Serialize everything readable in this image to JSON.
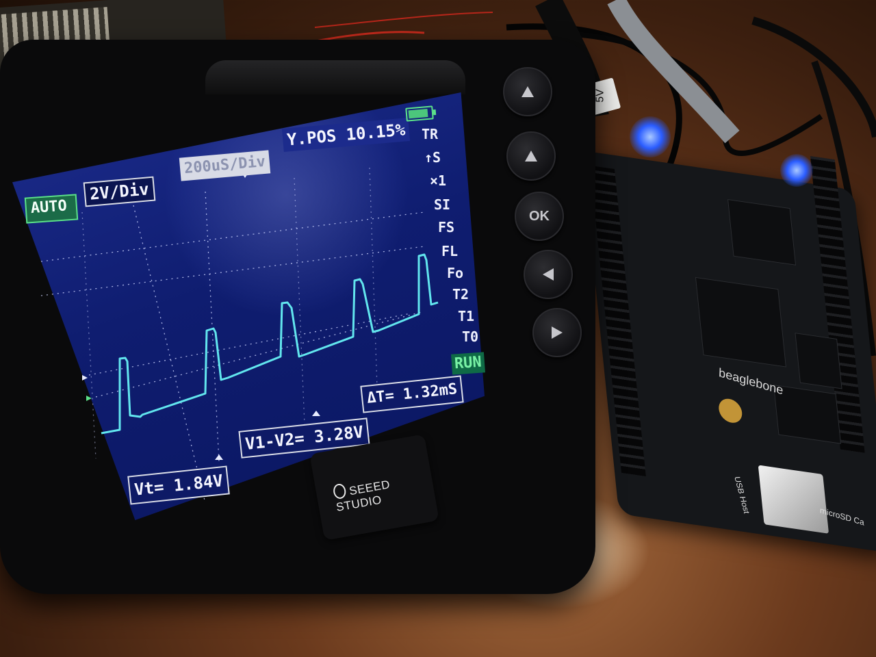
{
  "scope": {
    "brand": "SEEED STUDIO",
    "mode": "AUTO",
    "volts_per_div": "2V/Div",
    "time_per_div": "200uS/Div",
    "ypos": "Y.POS 10.15%",
    "side_menu": [
      "TR",
      "↑S",
      "×1",
      "SI",
      "FS",
      "FL",
      "Fo",
      "T2",
      "T1",
      "T0"
    ],
    "run_state": "RUN",
    "vt": "Vt= 1.84V",
    "v1v2": "V1-V2= 3.28V",
    "delta_t": "ΔT= 1.32mS",
    "ok_button": "OK",
    "battery_icon": "battery-icon",
    "trace_color": "#62e6ee"
  },
  "board": {
    "logo": "beaglebone",
    "usb_label": "USB Host",
    "sd_label": "microSD Ca",
    "power_tag": "5V"
  }
}
